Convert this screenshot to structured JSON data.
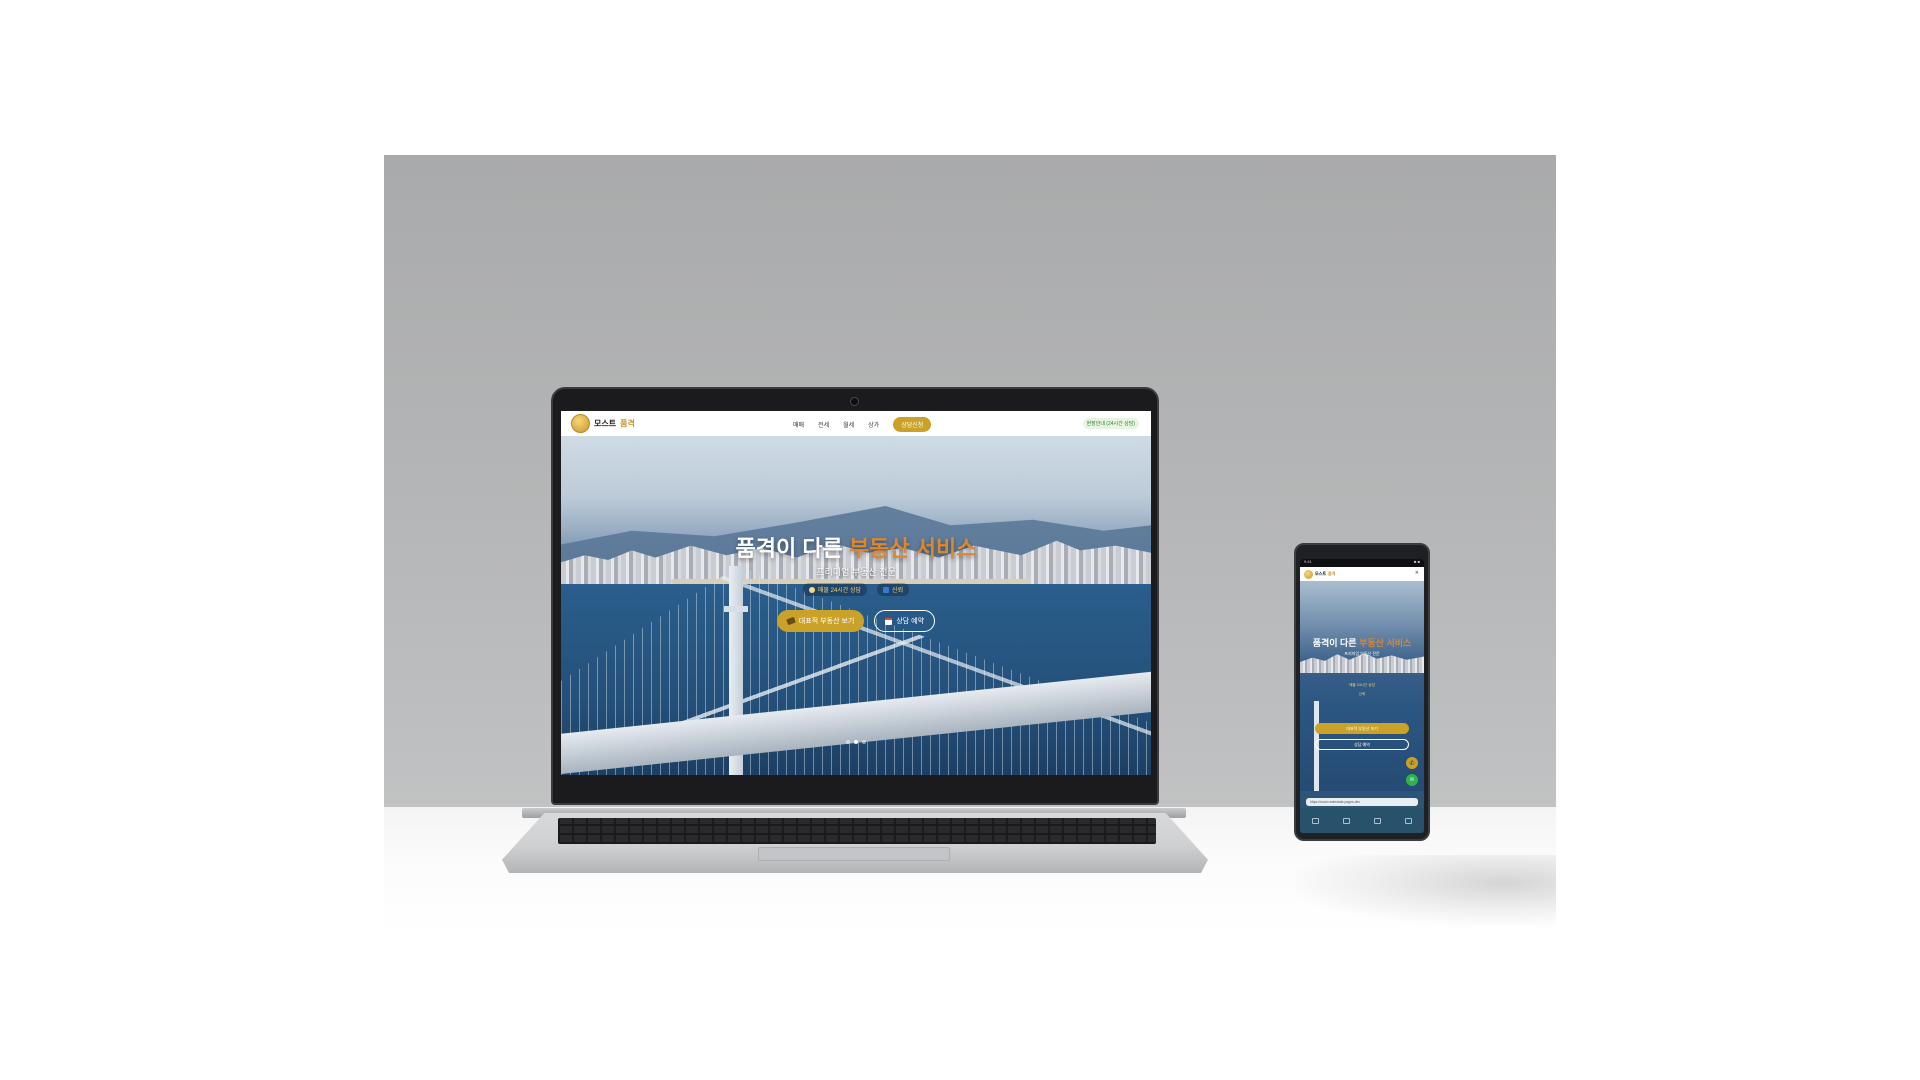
{
  "laptop_site": {
    "logo": {
      "name": "모스트",
      "accent": "품격"
    },
    "nav": {
      "items": [
        "매매",
        "전세",
        "월세",
        "상가"
      ],
      "cta": "상담신청"
    },
    "header_badge": "현장안내 (24시간 상담)",
    "hero": {
      "title_plain": "품격이 다른",
      "title_accent": "부동산 서비스",
      "subtitle": "프리미엄 부동산 전문",
      "badges": [
        "매물 24시간 상담",
        "신뢰"
      ],
      "primary_button": "대표적 부동산 보기",
      "secondary_button": "상담 예약"
    }
  },
  "phone_site": {
    "status": {
      "left": "9:41",
      "right": "■ ■"
    },
    "logo": {
      "name": "모스트",
      "accent": "품격"
    },
    "close": "×",
    "hero": {
      "title_plain": "품격이 다른",
      "title_accent": "부동산 서비스",
      "subtitle": "프리미엄 부동산 전문",
      "badges": [
        "매물 24시간 상담",
        "신뢰"
      ],
      "primary_button": "대표적 부동산 보기",
      "secondary_button": "상담 예약"
    },
    "fab_call": "✆",
    "fab_chat": "✉",
    "url": "https://most-realestate.pages.dev"
  },
  "colors": {
    "accent_gold": "#c9a227",
    "accent_orange": "#e0862b",
    "sea_blue": "#2a5e8c"
  }
}
